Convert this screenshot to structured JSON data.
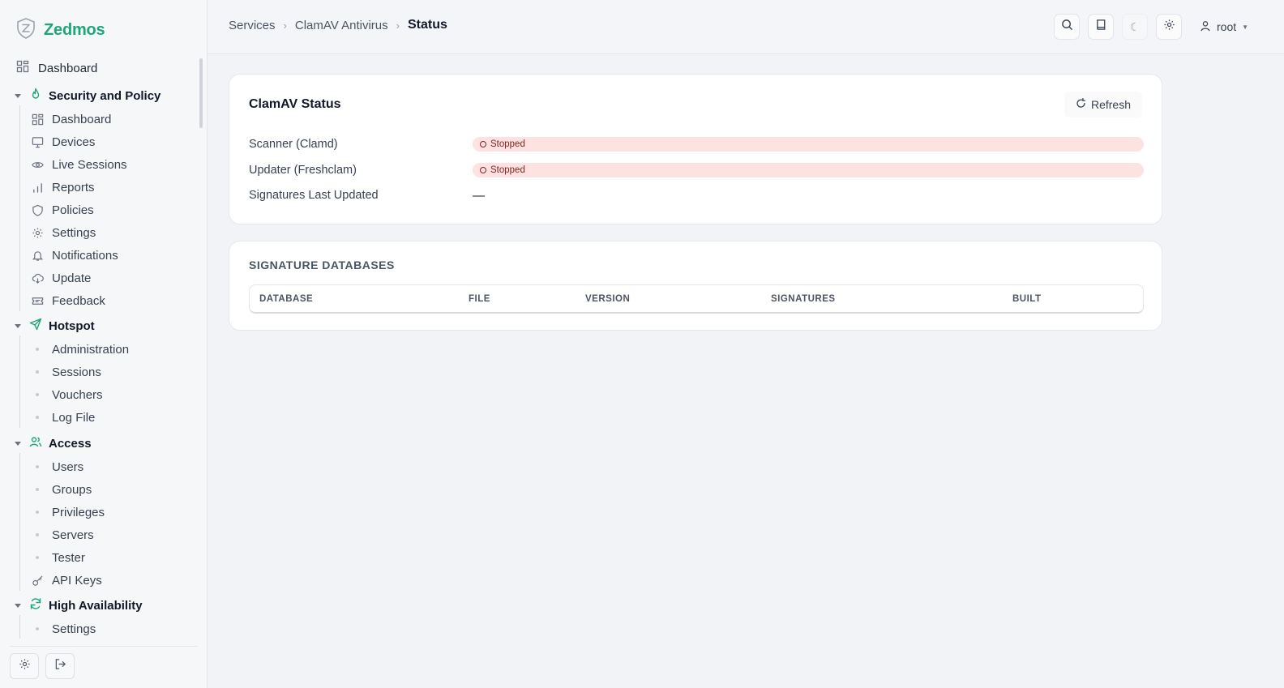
{
  "brand": {
    "name": "Zedmos"
  },
  "sidebar": {
    "top_item": {
      "label": "Dashboard",
      "icon": "grid-icon"
    },
    "groups": [
      {
        "label": "Security and Policy",
        "icon": "flame-icon",
        "items": [
          {
            "label": "Dashboard",
            "icon": "grid-icon"
          },
          {
            "label": "Devices",
            "icon": "monitor-icon"
          },
          {
            "label": "Live Sessions",
            "icon": "eye-icon"
          },
          {
            "label": "Reports",
            "icon": "bar-chart-icon"
          },
          {
            "label": "Policies",
            "icon": "shield-icon"
          },
          {
            "label": "Settings",
            "icon": "gear-icon"
          },
          {
            "label": "Notifications",
            "icon": "bell-icon"
          },
          {
            "label": "Update",
            "icon": "cloud-download-icon"
          },
          {
            "label": "Feedback",
            "icon": "ticket-icon"
          }
        ]
      },
      {
        "label": "Hotspot",
        "icon": "send-icon",
        "items": [
          {
            "label": "Administration"
          },
          {
            "label": "Sessions"
          },
          {
            "label": "Vouchers"
          },
          {
            "label": "Log File"
          }
        ]
      },
      {
        "label": "Access",
        "icon": "users-icon",
        "items": [
          {
            "label": "Users"
          },
          {
            "label": "Groups"
          },
          {
            "label": "Privileges"
          },
          {
            "label": "Servers"
          },
          {
            "label": "Tester"
          },
          {
            "label": "API Keys",
            "icon": "key-icon"
          }
        ]
      },
      {
        "label": "High Availability",
        "icon": "refresh-icon",
        "items": [
          {
            "label": "Settings"
          }
        ]
      }
    ]
  },
  "breadcrumb": {
    "items": [
      "Services",
      "ClamAV Antivirus"
    ],
    "current": "Status"
  },
  "user": {
    "name": "root"
  },
  "status_card": {
    "title": "ClamAV Status",
    "refresh_label": "Refresh",
    "rows": [
      {
        "label": "Scanner (Clamd)",
        "status": "Stopped"
      },
      {
        "label": "Updater (Freshclam)",
        "status": "Stopped"
      },
      {
        "label": "Signatures Last Updated",
        "value": "—"
      }
    ]
  },
  "db_card": {
    "title": "SIGNATURE DATABASES",
    "columns": [
      "DATABASE",
      "FILE",
      "VERSION",
      "SIGNATURES",
      "BUILT"
    ]
  },
  "colors": {
    "accent": "#1fa57a",
    "badge_bg": "#fde2e2",
    "badge_text": "#8b1d1d"
  }
}
